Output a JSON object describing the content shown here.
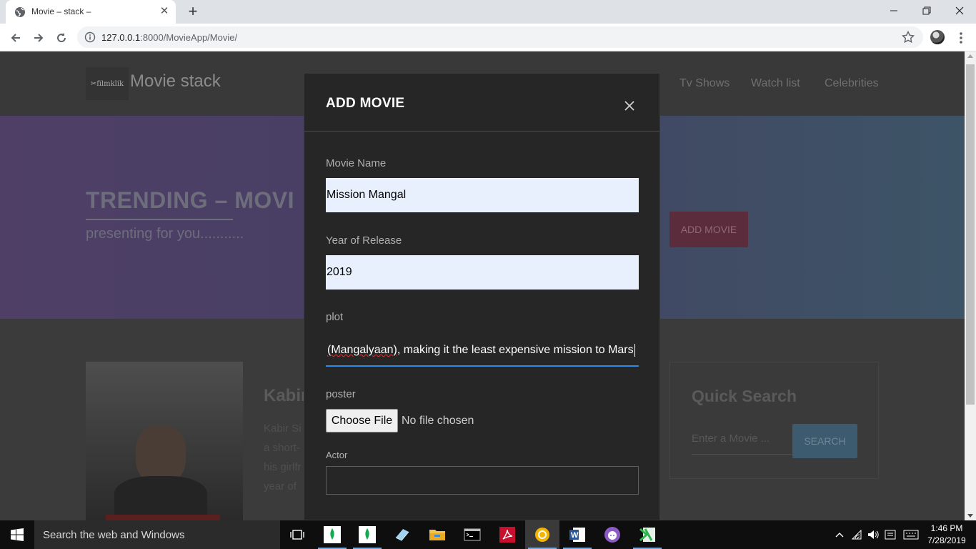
{
  "browser": {
    "tab_title": "Movie – stack –",
    "url_host": "127.0.0.1",
    "url_rest": ":8000/MovieApp/Movie/"
  },
  "site": {
    "logo_text": "filmklik",
    "title": "Movie stack",
    "nav": [
      "Tv Shows",
      "Watch list",
      "Celebrities"
    ],
    "hero_title": "TRENDING – MOVI",
    "hero_sub": "presenting for you...........",
    "add_movie_label": "ADD MOVIE",
    "movie_title": "Kabir",
    "movie_desc": [
      "Kabir Si",
      "a short-",
      "his girlfr",
      "year of"
    ],
    "quick_search": {
      "title": "Quick Search",
      "placeholder": "Enter a Movie ...",
      "button": "SEARCH"
    }
  },
  "modal": {
    "title": "ADD MOVIE",
    "name_label": "Movie Name",
    "name_value": "Mission Mangal",
    "year_label": "Year of Release",
    "year_value": "2019",
    "plot_label": "plot",
    "plot_value_misspelled": "(Mangalyaan)",
    "plot_value_rest": ", making it the least expensive mission to Mars",
    "poster_label": "poster",
    "file_button": "Choose File",
    "file_status": "No file chosen",
    "actor_label": "Actor",
    "actor_value": ""
  },
  "taskbar": {
    "search_text": "Search the web and Windows",
    "time": "1:46 PM",
    "date": "7/28/2019"
  },
  "colors": {
    "accent_blue": "#2d8be8",
    "modal_bg": "#262626",
    "autofill_bg": "#e8f0fe"
  }
}
